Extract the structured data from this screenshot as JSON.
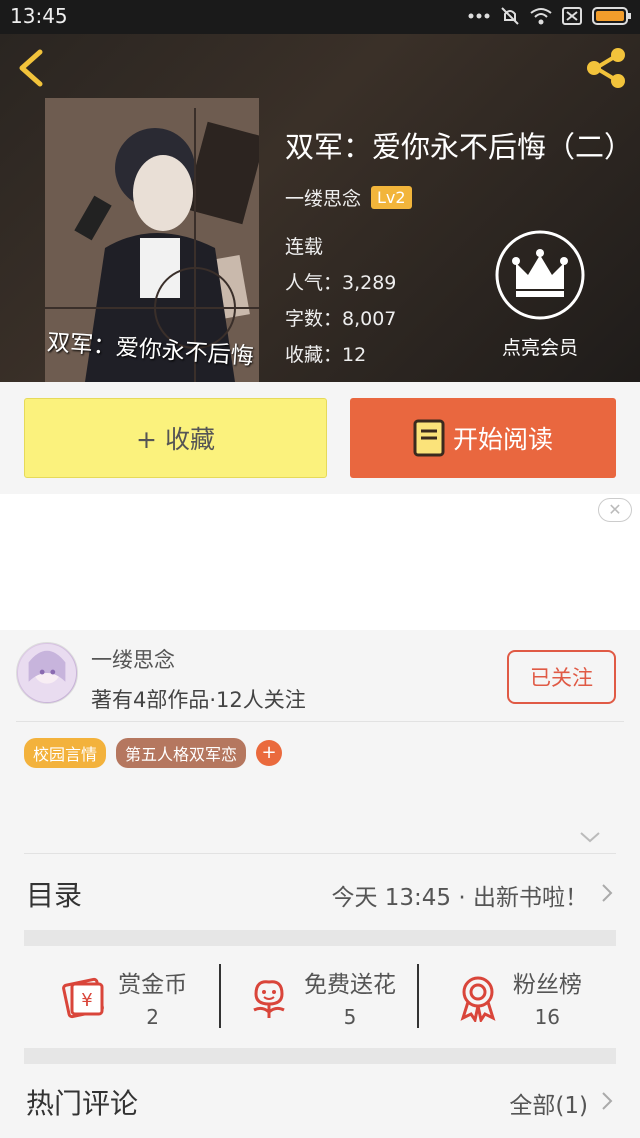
{
  "status_bar": {
    "time": "13:45"
  },
  "book": {
    "cover_text": "双军：爱你永不后悔",
    "title": "双军：爱你永不后悔（二）",
    "author": "一缕思念",
    "level": "Lv2",
    "state": "连载",
    "popularity": "人气：3,289",
    "words": "字数：8,007",
    "favorites": "收藏：12"
  },
  "vip": {
    "label": "点亮会员"
  },
  "actions": {
    "favorite_label": "+ 收藏",
    "read_label": "开始阅读"
  },
  "ad": {
    "close_label": "✕"
  },
  "author_card": {
    "name": "一缕思念",
    "works": "著有4部作品·12人关注",
    "follow_label": "已关注"
  },
  "tags": [
    {
      "label": "校园言情"
    },
    {
      "label": "第五人格双军恋"
    }
  ],
  "tag_add_label": "+",
  "toc": {
    "label": "目录",
    "update": "今天 13:45 · 出新书啦！"
  },
  "stats": [
    {
      "name": "赏金币",
      "value": "2",
      "icon": "coin-icon"
    },
    {
      "name": "免费送花",
      "value": "5",
      "icon": "flower-icon"
    },
    {
      "name": "粉丝榜",
      "value": "16",
      "icon": "medal-icon"
    }
  ],
  "comments": {
    "label": "热门评论",
    "all": "全部(1)"
  },
  "colors": {
    "accent_orange": "#e9673f",
    "fav_yellow": "#fbf27d",
    "tag_yellow": "#f3b23c",
    "tag_brown": "#b5775f",
    "follow_red": "#e05a45"
  }
}
